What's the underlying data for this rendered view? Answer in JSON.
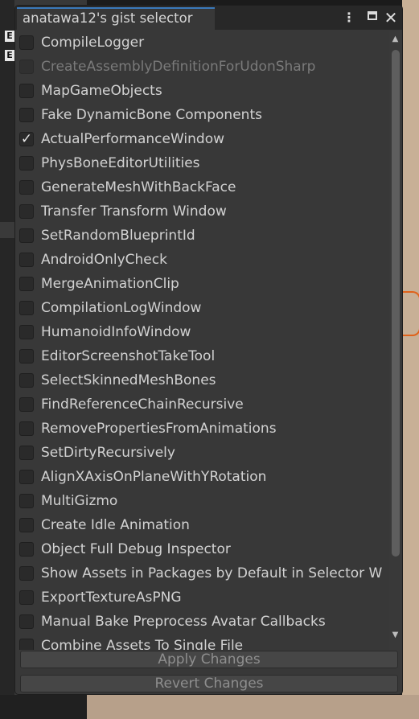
{
  "window": {
    "title": "anatawa12's gist selector",
    "menu_icon": "kebab-menu-icon",
    "maximize_icon": "maximize-icon",
    "close_icon": "close-icon"
  },
  "background": {
    "left_tags": [
      "E",
      "E"
    ]
  },
  "items": [
    {
      "label": "CompileLogger",
      "checked": false,
      "disabled": false
    },
    {
      "label": "CreateAssemblyDefinitionForUdonSharp",
      "checked": false,
      "disabled": true
    },
    {
      "label": "MapGameObjects",
      "checked": false,
      "disabled": false
    },
    {
      "label": "Fake DynamicBone Components",
      "checked": false,
      "disabled": false
    },
    {
      "label": "ActualPerformanceWindow",
      "checked": true,
      "disabled": false
    },
    {
      "label": "PhysBoneEditorUtilities",
      "checked": false,
      "disabled": false
    },
    {
      "label": "GenerateMeshWithBackFace",
      "checked": false,
      "disabled": false
    },
    {
      "label": "Transfer Transform Window",
      "checked": false,
      "disabled": false
    },
    {
      "label": "SetRandomBlueprintId",
      "checked": false,
      "disabled": false
    },
    {
      "label": "AndroidOnlyCheck",
      "checked": false,
      "disabled": false
    },
    {
      "label": "MergeAnimationClip",
      "checked": false,
      "disabled": false
    },
    {
      "label": "CompilationLogWindow",
      "checked": false,
      "disabled": false
    },
    {
      "label": "HumanoidInfoWindow",
      "checked": false,
      "disabled": false
    },
    {
      "label": "EditorScreenshotTakeTool",
      "checked": false,
      "disabled": false
    },
    {
      "label": "SelectSkinnedMeshBones",
      "checked": false,
      "disabled": false
    },
    {
      "label": "FindReferenceChainRecursive",
      "checked": false,
      "disabled": false
    },
    {
      "label": "RemovePropertiesFromAnimations",
      "checked": false,
      "disabled": false
    },
    {
      "label": "SetDirtyRecursively",
      "checked": false,
      "disabled": false
    },
    {
      "label": "AlignXAxisOnPlaneWithYRotation",
      "checked": false,
      "disabled": false
    },
    {
      "label": "MultiGizmo",
      "checked": false,
      "disabled": false
    },
    {
      "label": "Create Idle Animation",
      "checked": false,
      "disabled": false
    },
    {
      "label": "Object Full Debug Inspector",
      "checked": false,
      "disabled": false
    },
    {
      "label": "Show Assets in Packages by Default in Selector W",
      "checked": false,
      "disabled": false
    },
    {
      "label": "ExportTextureAsPNG",
      "checked": false,
      "disabled": false
    },
    {
      "label": "Manual Bake Preprocess Avatar Callbacks",
      "checked": false,
      "disabled": false
    },
    {
      "label": "Combine Assets To Single File",
      "checked": false,
      "disabled": false
    }
  ],
  "checkmark": "✓",
  "buttons": {
    "apply": "Apply Changes",
    "revert": "Revert Changes"
  }
}
